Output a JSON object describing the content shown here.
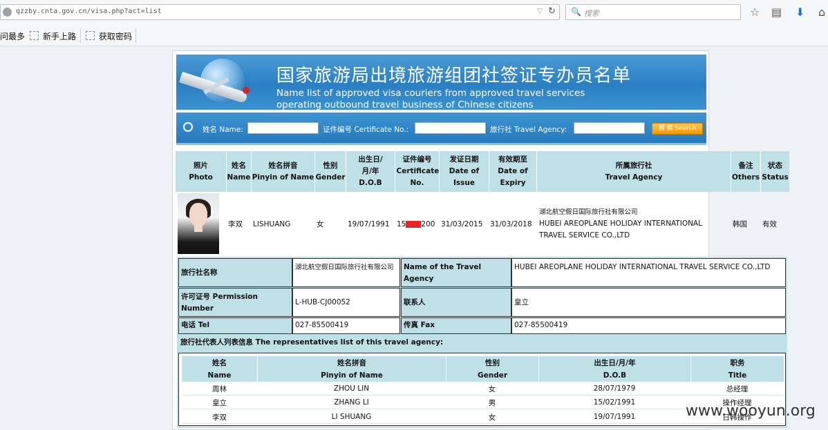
{
  "browser": {
    "url": "qzzby.cnta.gov.cn/visa.php?act=list",
    "search_placeholder": "搜索",
    "bookmarks": [
      "问最多",
      "新手上路",
      "获取密码"
    ]
  },
  "banner": {
    "title_cn": "国家旅游局出境旅游组团社签证专办员名单",
    "title_en_1": "Name list of approved visa couriers from approved travel services",
    "title_en_2": "operating outbound travel business of Chinese citizens"
  },
  "search_form": {
    "name_label": "姓名 Name:",
    "cert_label": "证件编号 Certificate No.:",
    "agency_label": "旅行社 Travel Agency:",
    "button": "搜 索 Search"
  },
  "list_headers": [
    {
      "cn": "照片",
      "en": "Photo"
    },
    {
      "cn": "姓名",
      "en": "Name"
    },
    {
      "cn": "姓名拼音",
      "en": "Pinyin of Name"
    },
    {
      "cn": "性别",
      "en": "Gender"
    },
    {
      "cn": "出生日/月/年",
      "en": "D.O.B"
    },
    {
      "cn": "证件编号",
      "en": "Certificate No."
    },
    {
      "cn": "发证日期",
      "en": "Date of Issue"
    },
    {
      "cn": "有效期至",
      "en": "Date of Expiry"
    },
    {
      "cn": "所属旅行社",
      "en": "Travel Agency"
    },
    {
      "cn": "备注",
      "en": "Others"
    },
    {
      "cn": "状态",
      "en": "Status"
    }
  ],
  "record": {
    "name": "李双",
    "pinyin": "LISHUANG",
    "gender": "女",
    "dob": "19/07/1991",
    "cert_prefix": "15",
    "cert_suffix": "200",
    "issue": "31/03/2015",
    "expiry": "31/03/2018",
    "agency_cn": "湖北航空假日国际旅行社有限公司",
    "agency_en": "HUBEI AREOPLANE HOLIDAY INTERNATIONAL TRAVEL SERVICE CO.,LTD",
    "others": "韩国",
    "status": "有效"
  },
  "agency_info": {
    "name_cn_label": "旅行社名称",
    "name_cn": "湖北航空假日国际旅行社有限公司",
    "name_en_label": "Name of the Travel Agency",
    "name_en": "HUBEI AREOPLANE HOLIDAY INTERNATIONAL TRAVEL SERVICE CO.,LTD",
    "permit_label": "许可证号 Permission Number",
    "permit": "L-HUB-CJ00052",
    "contact_label": "联系人",
    "contact": "皇立",
    "tel_label": "电话 Tel",
    "tel": "027-85500419",
    "fax_label": "传真 Fax",
    "fax": "027-85500419",
    "reps_title": "旅行社代表人列表信息 The representatives list of this travel agency:"
  },
  "reps_headers": [
    {
      "cn": "姓名",
      "en": "Name"
    },
    {
      "cn": "姓名拼音",
      "en": "Pinyin of Name"
    },
    {
      "cn": "性别",
      "en": "Gender"
    },
    {
      "cn": "出生日/月/年",
      "en": "D.O.B"
    },
    {
      "cn": "职务",
      "en": "Title"
    }
  ],
  "reps": [
    {
      "name": "周林",
      "pinyin": "ZHOU LIN",
      "gender": "女",
      "dob": "28/07/1979",
      "title": "总经理"
    },
    {
      "name": "皇立",
      "pinyin": "ZHANG LI",
      "gender": "男",
      "dob": "15/02/1991",
      "title": "操作经理"
    },
    {
      "name": "李双",
      "pinyin": "LI SHUANG",
      "gender": "女",
      "dob": "19/07/1991",
      "title": "日韩操作"
    }
  ],
  "watermark": "www.wooyun.org"
}
